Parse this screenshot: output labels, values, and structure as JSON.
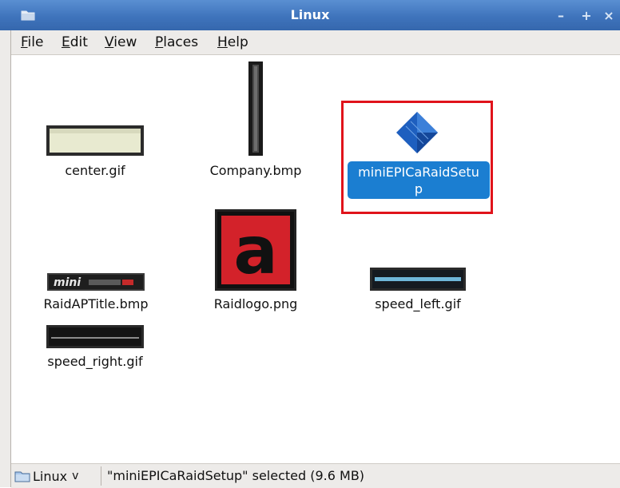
{
  "window": {
    "title": "Linux"
  },
  "window_controls": {
    "minimize": "–",
    "maximize": "+",
    "close": "×"
  },
  "menu": [
    {
      "label": "File",
      "key": "F",
      "rest": "ile"
    },
    {
      "label": "Edit",
      "key": "E",
      "rest": "dit"
    },
    {
      "label": "View",
      "key": "V",
      "rest": "iew"
    },
    {
      "label": "Places",
      "key": "P",
      "rest": "laces"
    },
    {
      "label": "Help",
      "key": "H",
      "rest": "elp"
    }
  ],
  "files": [
    {
      "name": "center.gif"
    },
    {
      "name": "Company.bmp"
    },
    {
      "name_line1": "miniEPICaRaidSetu",
      "name_line2": "p",
      "selected": true
    },
    {
      "name": "RaidAPTitle.bmp",
      "thumb_text": "mini"
    },
    {
      "name": "Raidlogo.png",
      "thumb_text": "a"
    },
    {
      "name": "speed_left.gif"
    },
    {
      "name": "speed_right.gif"
    }
  ],
  "status": {
    "location": "Linux",
    "location_arrow": "v",
    "text": "\"miniEPICaRaidSetup\" selected (9.6 MB)"
  },
  "colors": {
    "titlebar": "#3f74bc",
    "selection": "#1b7ed1",
    "highlight_box": "#e0131b",
    "chrome": "#edebe9"
  }
}
